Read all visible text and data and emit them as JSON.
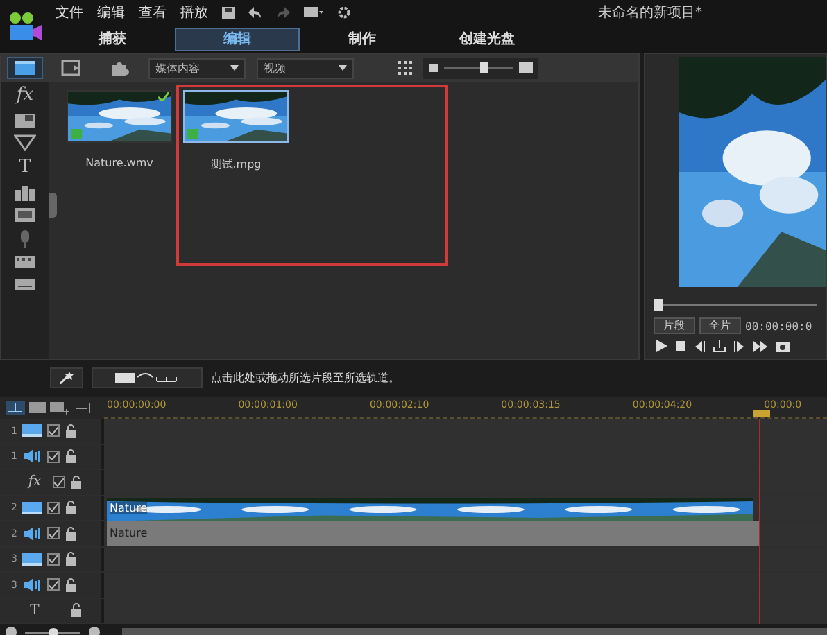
{
  "menu": [
    "文件",
    "编辑",
    "查看",
    "播放"
  ],
  "project_title": "未命名的新项目*",
  "tabs": [
    {
      "label": "捕获",
      "selected": false
    },
    {
      "label": "编辑",
      "selected": true
    },
    {
      "label": "制作",
      "selected": false
    },
    {
      "label": "创建光盘",
      "selected": false
    }
  ],
  "library": {
    "toolbar_buttons": [
      {
        "kind": "media",
        "selected": true
      },
      {
        "kind": "import",
        "selected": false
      },
      {
        "kind": "plugin",
        "selected": false
      }
    ],
    "dropdowns": [
      {
        "value": "媒体内容"
      },
      {
        "value": "视频"
      }
    ],
    "thumb_size": {
      "level": 0.6
    },
    "sidebar": [
      {
        "kind": "glyph",
        "glyph": "fx"
      },
      {
        "kind": "pip"
      },
      {
        "kind": "particle"
      },
      {
        "kind": "glyph",
        "glyph": "T"
      },
      {
        "kind": "transition"
      },
      {
        "kind": "menu"
      },
      {
        "kind": "mic"
      },
      {
        "kind": "chapter"
      },
      {
        "kind": "subtitle"
      }
    ],
    "media": [
      {
        "name": "Nature.wmv",
        "checked": true,
        "selected": false
      },
      {
        "name": "测试.mpg",
        "checked": false,
        "selected": true,
        "highlighted": true
      }
    ]
  },
  "preview": {
    "scrub": {
      "level": 0
    },
    "modes": [
      "片段",
      "全片"
    ],
    "timecode": "00:00:00:0"
  },
  "timeline": {
    "hint": "点击此处或拖动所选片段至所选轨道。",
    "ruler": [
      "00:00:00:00",
      "00:00:01:00",
      "00:00:02:10",
      "00:00:03:15",
      "00:00:04:20",
      "00:00:0"
    ],
    "playhead": {
      "level": 0.91
    },
    "tracks": [
      {
        "kind": "video",
        "number": "1",
        "checked": true
      },
      {
        "kind": "audio",
        "number": "1",
        "checked": true
      },
      {
        "kind": "effect",
        "glyph": "fx",
        "checked": true
      },
      {
        "kind": "video",
        "number": "2",
        "checked": true,
        "clip": "Nature"
      },
      {
        "kind": "audio",
        "number": "2",
        "checked": true,
        "clip": "Nature"
      },
      {
        "kind": "video",
        "number": "3",
        "checked": true
      },
      {
        "kind": "audio",
        "number": "3",
        "checked": true
      },
      {
        "kind": "title",
        "glyph": "T"
      }
    ],
    "zoom": {
      "level": 0.5
    }
  }
}
